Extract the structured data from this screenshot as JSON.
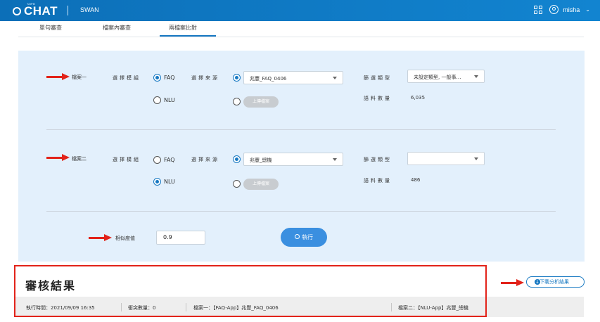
{
  "topbar": {
    "logo_small": "TAIPEI",
    "logo_text": "CHAT",
    "app_name": "SWAN",
    "apps_icon": "grid-icon",
    "user_icon": "user-circle-icon",
    "user_name": "misha",
    "dropdown_icon": "chevron-down-icon"
  },
  "tabs": [
    {
      "label": "單句審查",
      "active": false
    },
    {
      "label": "檔案內審查",
      "active": false
    },
    {
      "label": "兩檔案比對",
      "active": true
    }
  ],
  "file1": {
    "label": "檔案一",
    "module_label": "選擇模組",
    "module_options": [
      "FAQ",
      "NLU"
    ],
    "module_selected": "FAQ",
    "source_label": "選擇來源",
    "source_value": "兆豐_FAQ_0406",
    "upload_label": "上傳檔案",
    "filter_label": "篩選類型",
    "filter_value": "未設定類型, 一般事…",
    "corpus_label": "語料數量",
    "corpus_count": "6,035"
  },
  "file2": {
    "label": "檔案二",
    "module_label": "選擇模組",
    "module_options": [
      "FAQ",
      "NLU"
    ],
    "module_selected": "NLU",
    "source_label": "選擇來源",
    "source_value": "兆豐_總機",
    "upload_label": "上傳檔案",
    "filter_label": "篩選類型",
    "filter_value": "",
    "corpus_label": "語料數量",
    "corpus_count": "486"
  },
  "similarity": {
    "label": "相似度值",
    "value": "0.9"
  },
  "execute_label": "執行",
  "results": {
    "title": "審核結果",
    "download_label": "下載分析結果",
    "exec_time": "執行時間：2021/09/09 16:35",
    "conflict_count": "衝突數量：0",
    "file1_info": "檔案一：【FAQ-App】兆豐_FAQ_0406",
    "file2_info": "檔案二：【NLU-App】兆豐_總機"
  },
  "colors": {
    "topbar": "#1284d0",
    "accent": "#1678c2",
    "panel_bg": "#e3f0fc",
    "annotation_red": "#e2231a",
    "execute_button": "#3a8fe0"
  }
}
